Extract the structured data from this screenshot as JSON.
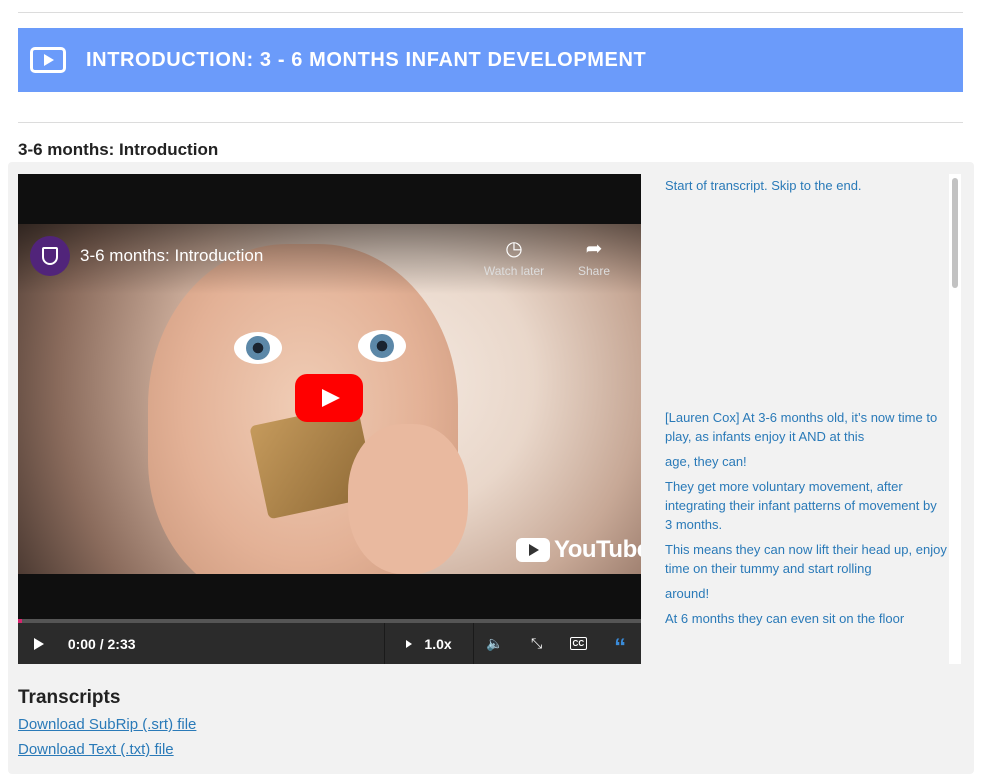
{
  "banner": {
    "title": "INTRODUCTION: 3 - 6 MONTHS INFANT DEVELOPMENT",
    "icon": "video-play-icon"
  },
  "section": {
    "title": "3-6 months: Introduction"
  },
  "video": {
    "title": "3-6 months: Introduction",
    "watch_later": "Watch later",
    "share": "Share",
    "watermark": "YouTube",
    "time": "0:00 / 2:33",
    "speed": "1.0x",
    "progress": 0,
    "accent": "#d6246e"
  },
  "transcript": {
    "skip": "Start of transcript. Skip to the end.",
    "lines": [
      "[Lauren Cox] At 3-6 months old, it’s now time to play, as infants enjoy it AND at this",
      "age, they can!",
      "They get more voluntary movement, after integrating their infant patterns of movement by 3 months.",
      "This means they can now lift their head up, enjoy time on their tummy and start rolling",
      "around!",
      "At 6 months they can even sit on the floor"
    ]
  },
  "transcripts": {
    "title": "Transcripts",
    "srt": "Download SubRip (.srt) file",
    "txt": "Download Text (.txt) file"
  },
  "colors": {
    "banner": "#6b9bfa",
    "link": "#2a7ab8",
    "youtube_red": "#ff0000"
  }
}
